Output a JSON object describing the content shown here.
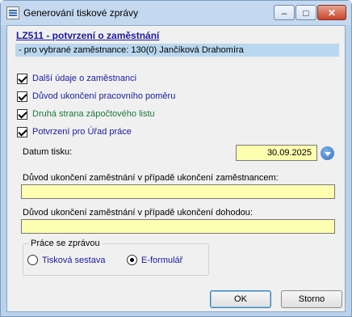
{
  "window": {
    "title": "Generování tiskové zprávy",
    "controls": {
      "minimize": "–",
      "maximize": "□",
      "close": "✕"
    }
  },
  "header": {
    "report_title": "LZ511 - potvrzení o zaměstnání",
    "subtitle": "- pro vybrané zaměstnance: 130(0) Jančíková Drahomíra"
  },
  "options": [
    {
      "label": "Další údaje o zaměstnanci",
      "checked": true,
      "color": "#1a1aa0"
    },
    {
      "label": "Důvod ukončení pracovního poměru",
      "checked": true,
      "color": "#1a1aa0"
    },
    {
      "label": "Druhá strana zápočtového listu",
      "checked": true,
      "color": "#1a7a3a"
    },
    {
      "label": "Potvrzení pro Úřad práce",
      "checked": true,
      "color": "#1a1aa0"
    }
  ],
  "print_date": {
    "label": "Datum tisku:",
    "value": "30.09.2025"
  },
  "reason_employee": {
    "label": "Důvod ukončení zaměstnání v případě ukončení zaměstnancem:",
    "value": ""
  },
  "reason_agreement": {
    "label": "Důvod ukončení zaměstnání v případě ukončení dohodou:",
    "value": ""
  },
  "work_with_report": {
    "title": "Práce se zprávou",
    "options": [
      {
        "label": "Tisková sestava",
        "selected": false
      },
      {
        "label": "E-formulář",
        "selected": true
      }
    ]
  },
  "buttons": {
    "ok": "OK",
    "cancel": "Storno"
  },
  "colors": {
    "input_bg": "#fefeb0",
    "subtitle_band": "#b9d7ee",
    "label_blue": "#1a1aa0",
    "label_green": "#1a7a3a"
  }
}
